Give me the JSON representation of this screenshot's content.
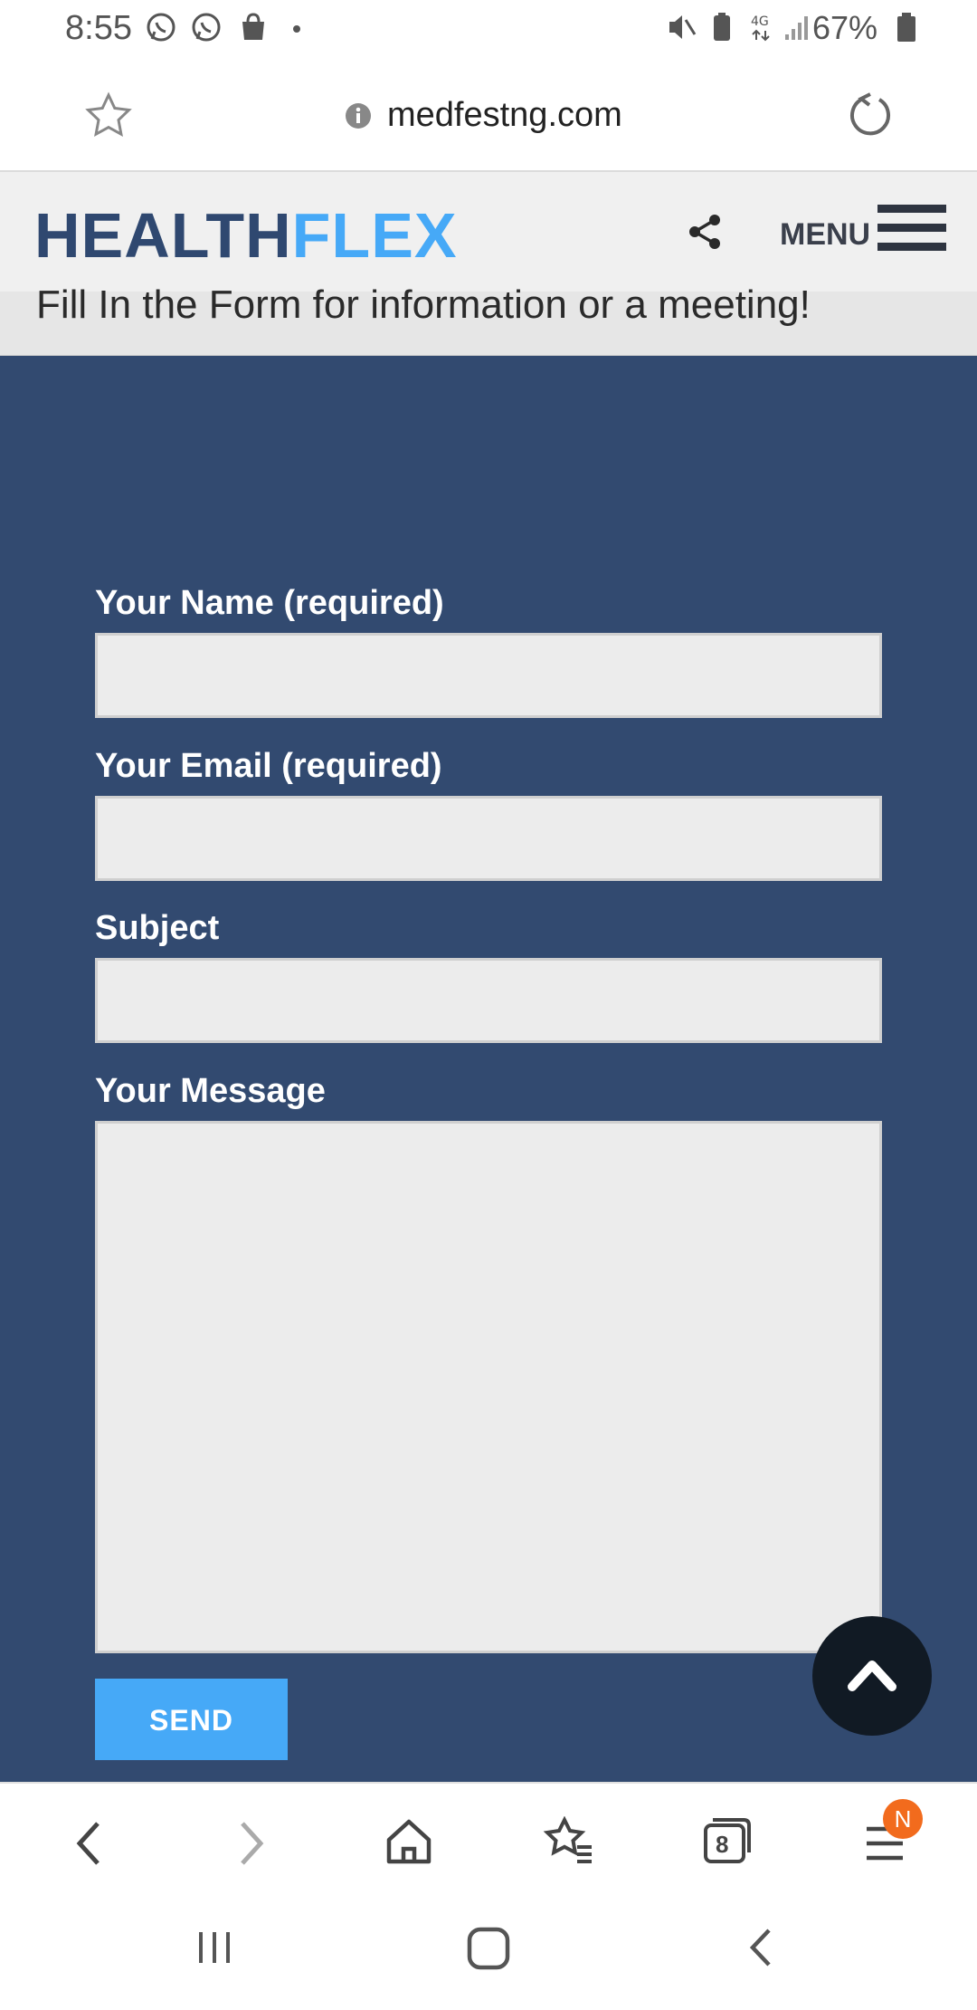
{
  "status_bar": {
    "time": "8:55",
    "battery": "67%",
    "network": "4G"
  },
  "browser": {
    "url": "medfestng.com"
  },
  "site": {
    "logo_part1": "HEALTH",
    "logo_part2": "FLEX",
    "menu_label": "MENU",
    "intro": "Fill In the Form for information or a meeting!"
  },
  "form": {
    "name_label": "Your Name (required)",
    "name_value": "",
    "email_label": "Your Email (required)",
    "email_value": "",
    "subject_label": "Subject",
    "subject_value": "",
    "message_label": "Your Message",
    "message_value": "",
    "send_label": "SEND"
  },
  "toolbar": {
    "tabs_count": "8",
    "menu_badge": "N"
  },
  "colors": {
    "form_bg": "#324a70",
    "accent": "#46a9f7",
    "logo_dark": "#2f4870",
    "badge": "#f26b1d"
  }
}
